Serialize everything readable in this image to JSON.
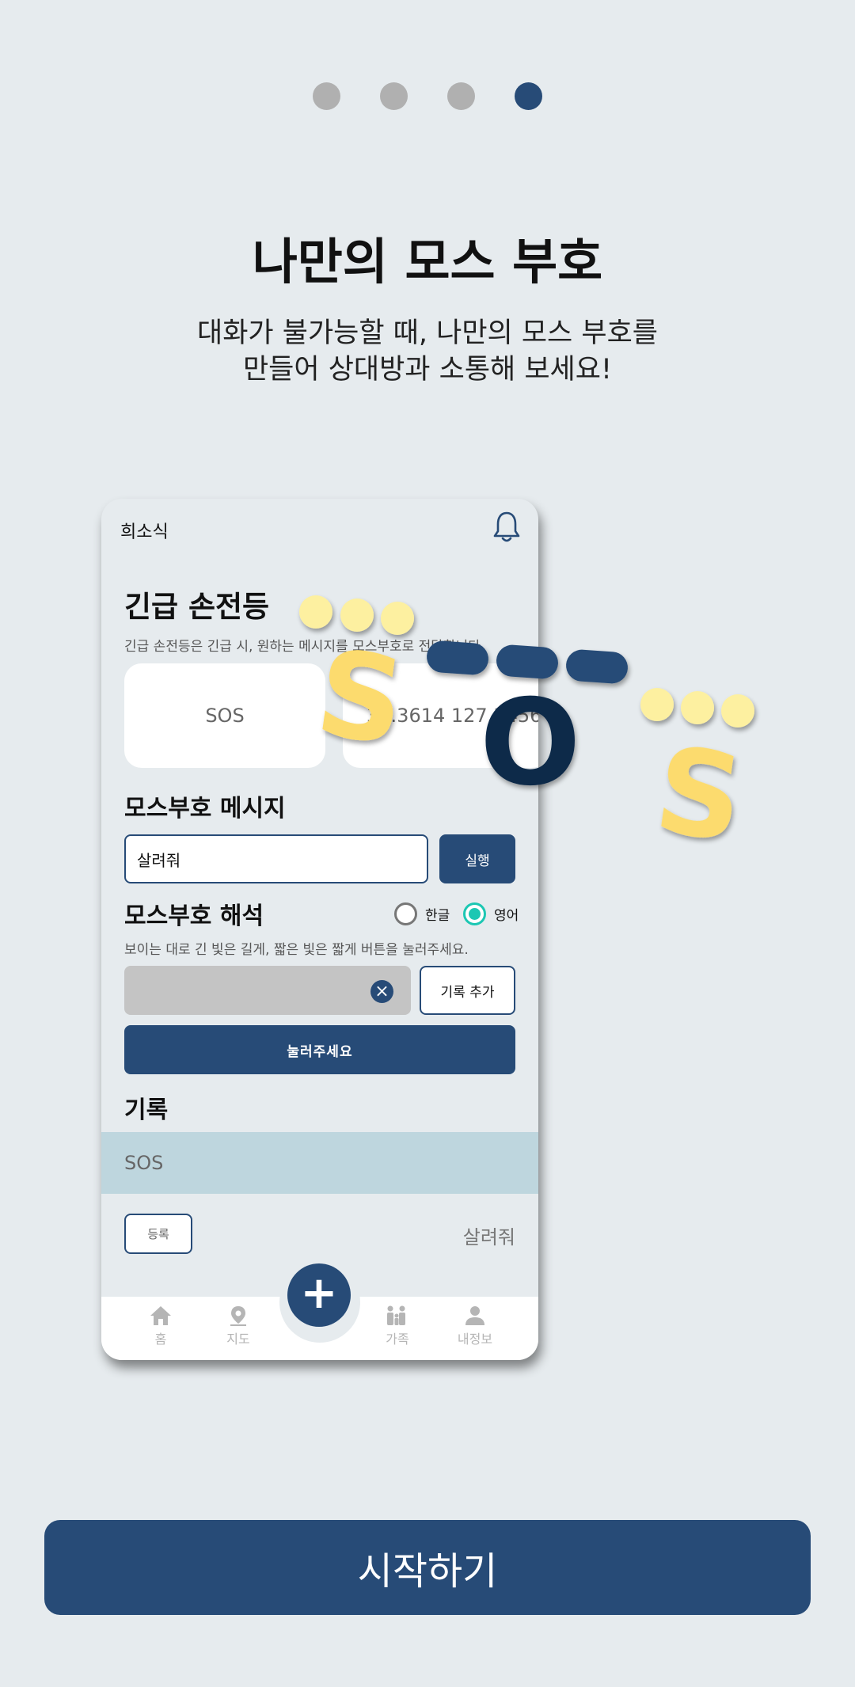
{
  "pager": {
    "count": 4,
    "active_index": 3
  },
  "title": "나만의 모스 부호",
  "subtitle_line1": "대화가 불가능할 때, 나만의 모스 부호를",
  "subtitle_line2": "만들어 상대방과 소통해 보세요!",
  "phone": {
    "header_title": "희소식",
    "flash_title": "긴급 손전등",
    "flash_desc": "긴급 손전등은 긴급 시, 원하는 메시지를 모스부호로 전달합니다.",
    "card_sos": "SOS",
    "card_coords": "37.3614 127.3456",
    "msg_title": "모스부호 메시지",
    "msg_value": "살려줘",
    "run_label": "실행",
    "decode_title": "모스부호 해석",
    "radio_korean": "한글",
    "radio_english": "영어",
    "radio_selected": "영어",
    "decode_desc": "보이는 대로 긴 빛은 길게, 짧은 빛은 짧게 버튼을 눌러주세요.",
    "add_record_label": "기록 추가",
    "press_label": "눌러주세요",
    "records_title": "기록",
    "record_item": "SOS",
    "register_label": "등록",
    "record_translation": "살려줘",
    "tabs": [
      "홈",
      "지도",
      "가족",
      "내정보"
    ],
    "fab_label": "+"
  },
  "overlay_letters": [
    "S",
    "O",
    "S"
  ],
  "start_label": "시작하기",
  "colors": {
    "primary": "#274b77",
    "yellow": "#fcdb6e",
    "dot_yellow": "#fdf0a0",
    "navy_o": "#0e2a4a",
    "accent": "#1cc7b3"
  }
}
